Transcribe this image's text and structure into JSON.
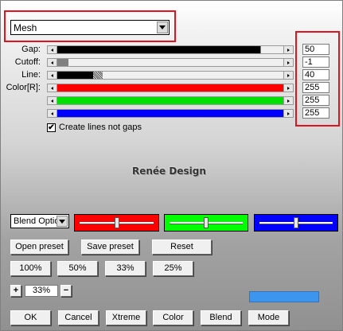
{
  "mode_combo": {
    "value": "Mesh"
  },
  "sliders": [
    {
      "label": "Gap:",
      "value": "50",
      "level": 0.9,
      "fill_color": "#000000"
    },
    {
      "label": "Cutoff:",
      "value": "-1",
      "level": 0.05,
      "fill_color": "#808080"
    },
    {
      "label": "Line:",
      "value": "40",
      "level": 0.2,
      "fill_color": "#000000"
    },
    {
      "label": "Color[R]:",
      "value": "255",
      "level": 1.0,
      "fill_color": "#ff0000"
    },
    {
      "label": "",
      "value": "255",
      "level": 1.0,
      "fill_color": "#00e000"
    },
    {
      "label": "",
      "value": "255",
      "level": 1.0,
      "fill_color": "#0000ff"
    }
  ],
  "checkbox": {
    "label": "Create lines not gaps",
    "checked": true,
    "mark": "✔"
  },
  "logo_text": "Renée Design",
  "blend_combo": {
    "value": "Blend Options"
  },
  "color_swatches": [
    {
      "color": "#ff0000",
      "level": 0.5
    },
    {
      "color": "#00ff00",
      "level": 0.5
    },
    {
      "color": "#0000ff",
      "level": 0.5
    }
  ],
  "preset_buttons": {
    "open": "Open preset",
    "save": "Save preset",
    "reset": "Reset"
  },
  "zoom_buttons": [
    "100%",
    "50%",
    "33%",
    "25%"
  ],
  "zoom_stepper": {
    "plus": "+",
    "value": "33%",
    "minus": "−"
  },
  "preview_color": "#3c96f0",
  "bottom_buttons": [
    "OK",
    "Cancel",
    "Xtreme",
    "Color",
    "Blend",
    "Mode"
  ]
}
